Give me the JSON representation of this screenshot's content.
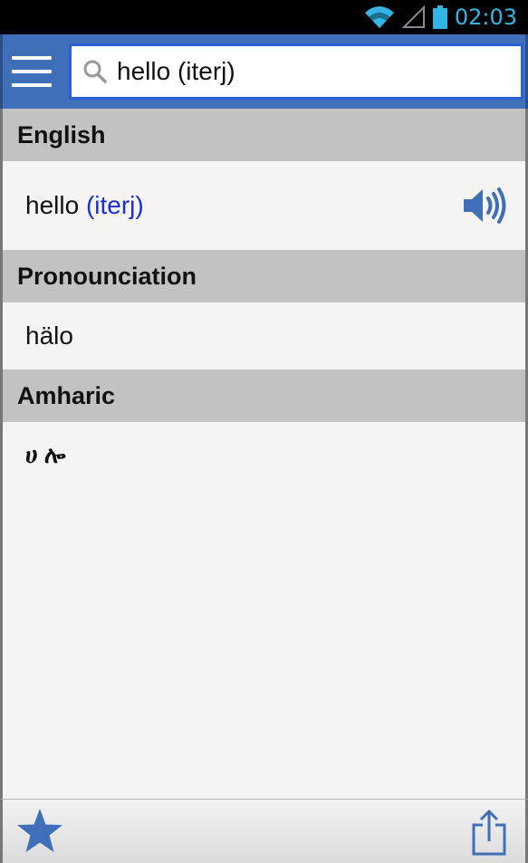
{
  "status_bar": {
    "time": "02:03",
    "icons": [
      "wifi-icon",
      "signal-icon",
      "battery-icon"
    ]
  },
  "app_bar": {
    "menu_icon": "hamburger-menu-icon"
  },
  "search": {
    "value": "hello (iterj)",
    "icon": "search-icon"
  },
  "sections": {
    "english": {
      "header": "English",
      "word": "hello",
      "part_of_speech": "(iterj)",
      "audio_icon": "speaker-icon"
    },
    "pronounciation": {
      "header": "Pronounciation",
      "text": "hälo"
    },
    "amharic": {
      "header": "Amharic",
      "text": "ሀ ሎ"
    }
  },
  "bottom_bar": {
    "left_icon": "star-icon",
    "right_icon": "share-icon"
  },
  "colors": {
    "app_bar": "#3f6fb8",
    "search_border": "#2a5fd6",
    "section_header": "#c2c2c2",
    "pos_tag": "#1a2fd6",
    "icon_blue": "#3f6fb8",
    "status_time": "#33b5e5"
  }
}
